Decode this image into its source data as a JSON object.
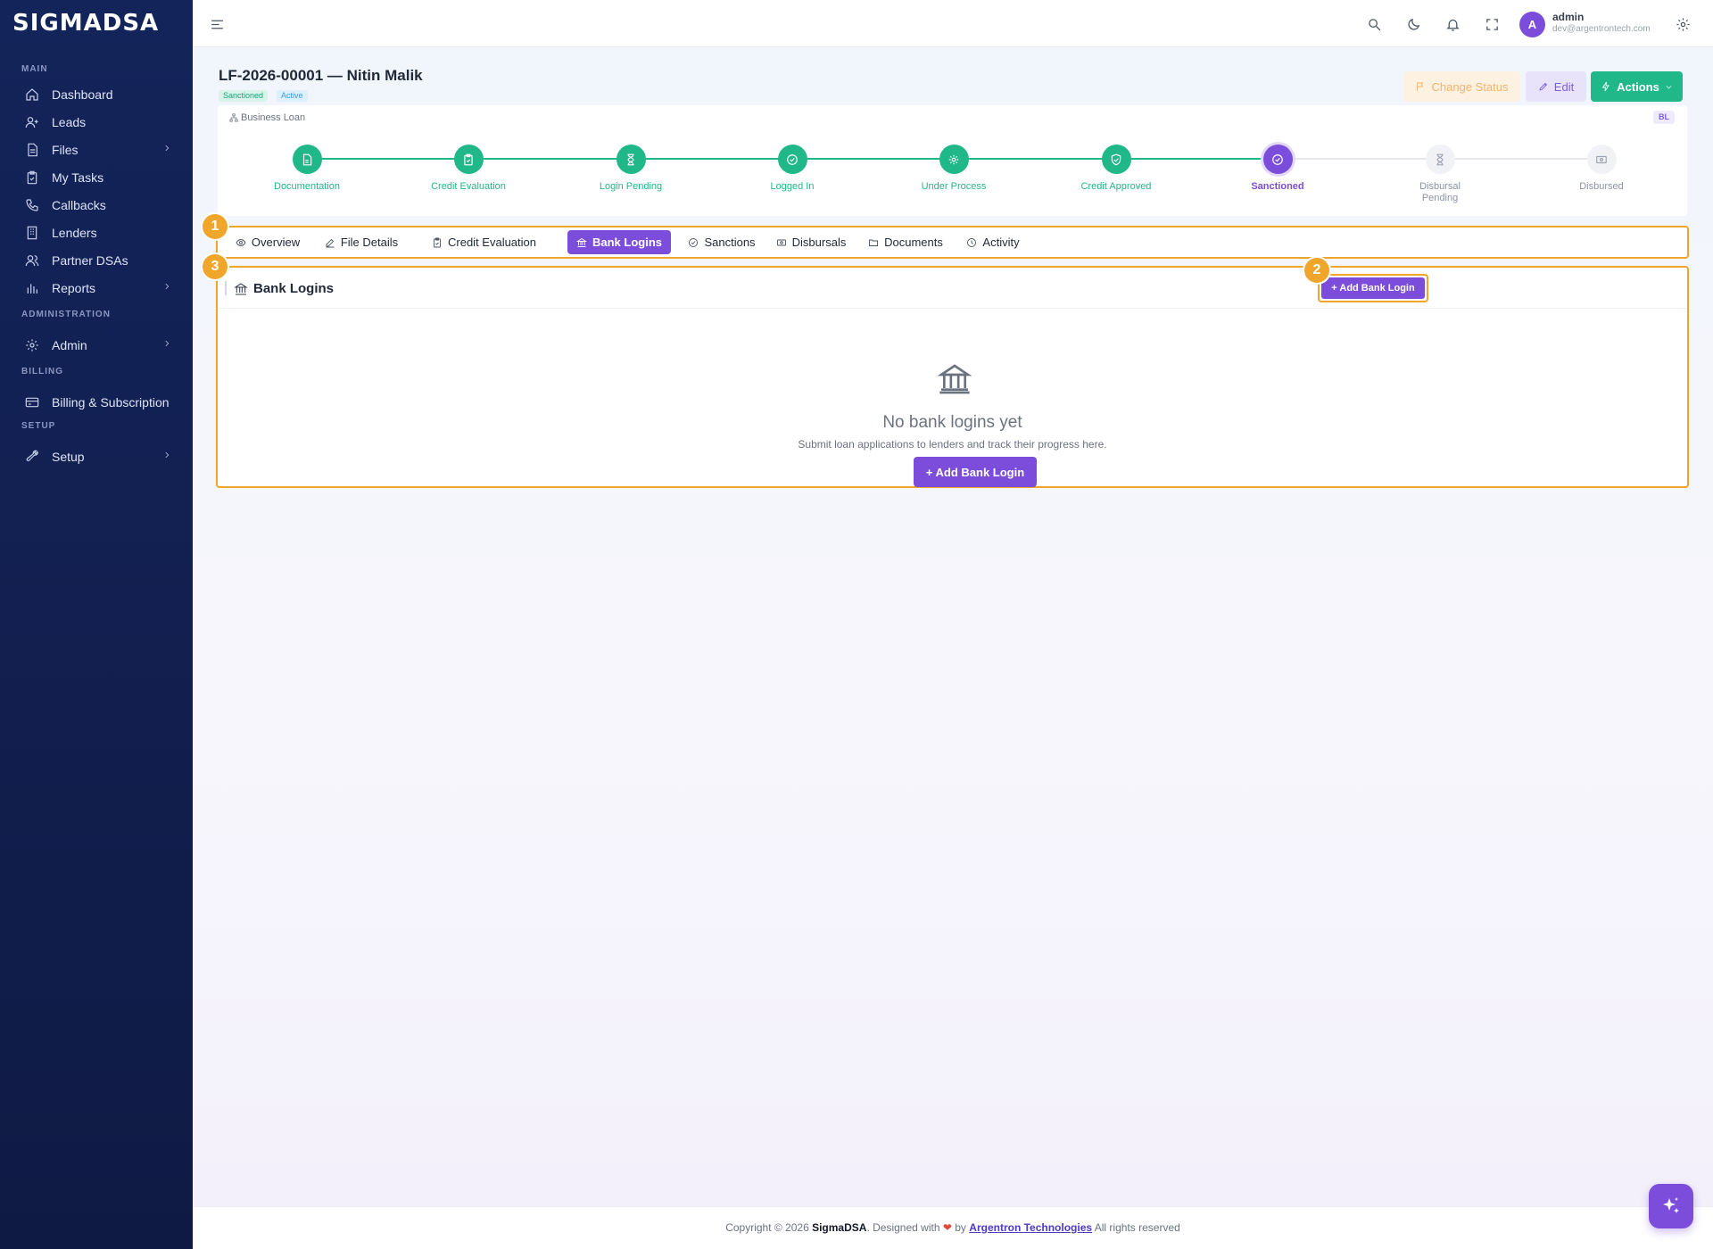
{
  "brand": {
    "logo": "SIGMADSA"
  },
  "sidebar": {
    "sections": [
      {
        "label": "MAIN"
      },
      {
        "label": "ADMINISTRATION"
      },
      {
        "label": "BILLING"
      },
      {
        "label": "SETUP"
      }
    ],
    "items": [
      {
        "label": "Dashboard",
        "icon": "home-icon"
      },
      {
        "label": "Leads",
        "icon": "user-plus-icon"
      },
      {
        "label": "Files",
        "icon": "file-icon",
        "has_submenu": true
      },
      {
        "label": "My Tasks",
        "icon": "clipboard-check-icon"
      },
      {
        "label": "Callbacks",
        "icon": "phone-icon"
      },
      {
        "label": "Lenders",
        "icon": "building-icon"
      },
      {
        "label": "Partner DSAs",
        "icon": "users-icon"
      },
      {
        "label": "Reports",
        "icon": "bar-chart-icon",
        "has_submenu": true
      },
      {
        "label": "Admin",
        "icon": "gear-icon",
        "has_submenu": true
      },
      {
        "label": "Billing & Subscription",
        "icon": "credit-card-icon"
      },
      {
        "label": "Setup",
        "icon": "wrench-icon",
        "has_submenu": true
      }
    ]
  },
  "topbar": {
    "user": {
      "initial": "A",
      "name": "admin",
      "email": "dev@argentrontech.com"
    }
  },
  "file": {
    "title": "LF-2026-00001 — Nitin Malik",
    "badges": [
      "Sanctioned",
      "Active"
    ],
    "loan_type": "Business Loan",
    "loan_code": "BL"
  },
  "header_actions": {
    "change_status": "Change Status",
    "edit": "Edit",
    "actions": "Actions"
  },
  "stages": [
    {
      "label": "Documentation",
      "state": "done"
    },
    {
      "label": "Credit Evaluation",
      "state": "done"
    },
    {
      "label": "Login Pending",
      "state": "done"
    },
    {
      "label": "Logged In",
      "state": "done"
    },
    {
      "label": "Under Process",
      "state": "done"
    },
    {
      "label": "Credit Approved",
      "state": "done"
    },
    {
      "label": "Sanctioned",
      "state": "current"
    },
    {
      "label": "Disbursal Pending",
      "state": "pending"
    },
    {
      "label": "Disbursed",
      "state": "pending"
    }
  ],
  "tabs": [
    {
      "label": "Overview"
    },
    {
      "label": "File Details"
    },
    {
      "label": "Credit Evaluation"
    },
    {
      "label": "Bank Logins",
      "active": true
    },
    {
      "label": "Sanctions"
    },
    {
      "label": "Disbursals"
    },
    {
      "label": "Documents"
    },
    {
      "label": "Activity"
    }
  ],
  "panel": {
    "title": "Bank Logins",
    "add_button": "+ Add Bank Login",
    "empty_title": "No bank logins yet",
    "empty_subtitle": "Submit loan applications to lenders and track their progress here.",
    "empty_button": "+ Add Bank Login"
  },
  "markers": [
    "1",
    "2",
    "3"
  ],
  "footer": {
    "prefix": "Copyright © 2026",
    "brand": "SigmaDSA",
    "middle": ". Designed with",
    "heart": "❤",
    "by": "by",
    "company": "Argentron Technologies",
    "suffix": "All rights reserved"
  },
  "colors": {
    "primary": "#7c4ddb",
    "success": "#20b789",
    "highlight": "#f0a62a",
    "sidebar": "#13245a"
  }
}
